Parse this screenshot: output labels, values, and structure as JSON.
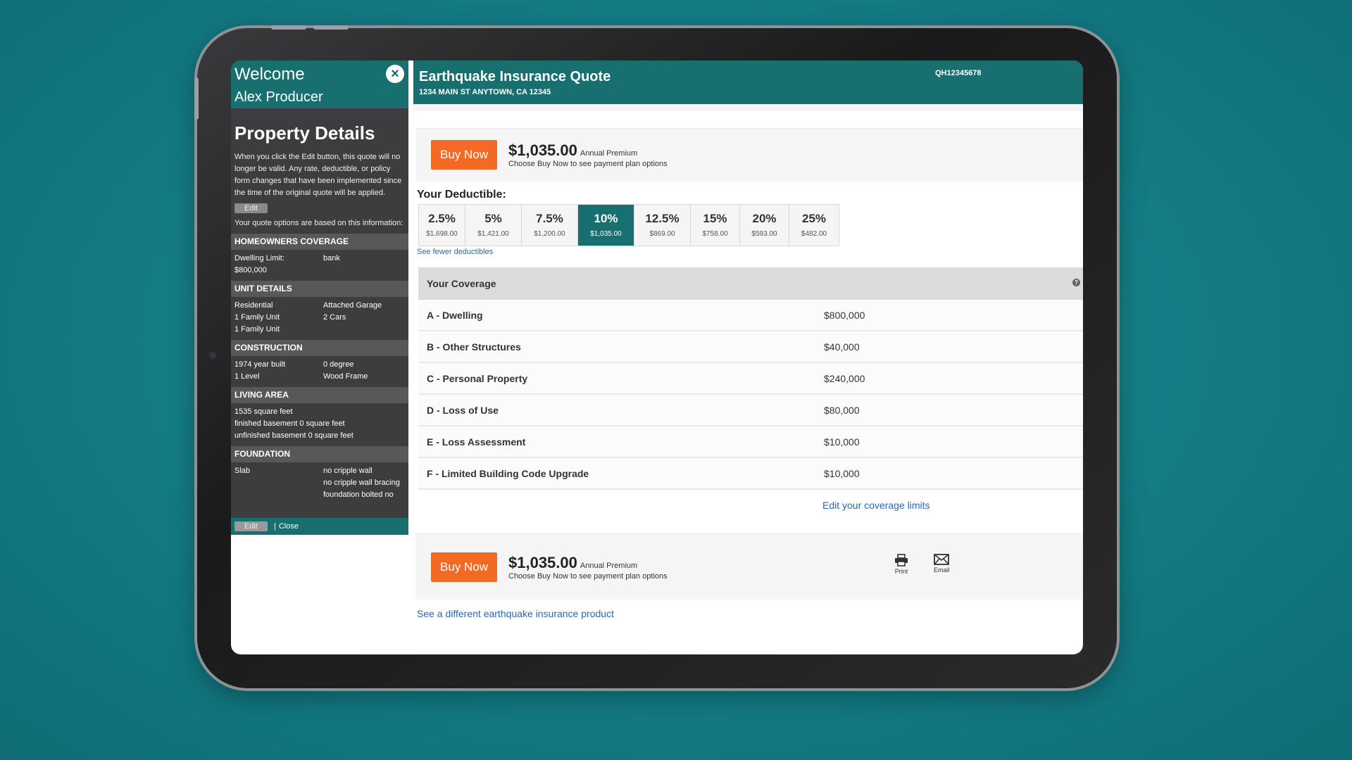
{
  "sidebar": {
    "welcome": "Welcome",
    "producer": "Alex Producer",
    "title": "Property Details",
    "edit_note": "When you click the Edit button, this quote will no longer be valid. Any rate, deductible, or policy form changes that have been implemented since the time of the original quote will be applied.",
    "edit_label": "Edit",
    "based_note": "Your quote options are based on this information:",
    "homeowners": {
      "heading": "HOMEOWNERS COVERAGE",
      "dwelling_label": "Dwelling Limit:",
      "dwelling_value": "$800,000",
      "lender": "bank"
    },
    "unit": {
      "heading": "UNIT DETAILS",
      "r1c1": "Residential",
      "r1c2": "Attached Garage",
      "r2c1": "1 Family Unit",
      "r2c2": "2 Cars",
      "r3c1": "1 Family Unit"
    },
    "construction": {
      "heading": "CONSTRUCTION",
      "r1c1": "1974 year built",
      "r1c2": "0 degree",
      "r2c1": "1 Level",
      "r2c2": "Wood Frame"
    },
    "living": {
      "heading": "LIVING AREA",
      "l1": "1535 square feet",
      "l2": "finished basement 0 square feet",
      "l3": "unfinished basement 0 square feet"
    },
    "foundation": {
      "heading": "FOUNDATION",
      "c1": "Slab",
      "l1": "no cripple wall",
      "l2": "no cripple wall bracing",
      "l3": "foundation bolted no"
    },
    "footer_edit": "Edit",
    "footer_sep": "|",
    "footer_close": "Close"
  },
  "header": {
    "title": "Earthquake Insurance Quote",
    "address": "1234 MAIN ST ANYTOWN, CA 12345",
    "quote_id": "QH12345678"
  },
  "buy": {
    "label": "Buy Now",
    "price": "$1,035.00",
    "price_label": "Annual Premium",
    "sub": "Choose Buy Now to see payment plan options"
  },
  "deductible": {
    "label": "Your Deductible:",
    "options": [
      {
        "pct": "2.5%",
        "amt": "$1,698.00"
      },
      {
        "pct": "5%",
        "amt": "$1,421.00"
      },
      {
        "pct": "7.5%",
        "amt": "$1,200.00"
      },
      {
        "pct": "10%",
        "amt": "$1,035.00"
      },
      {
        "pct": "12.5%",
        "amt": "$869.00"
      },
      {
        "pct": "15%",
        "amt": "$758.00"
      },
      {
        "pct": "20%",
        "amt": "$593.00"
      },
      {
        "pct": "25%",
        "amt": "$482.00"
      }
    ],
    "selected": "10%",
    "see_fewer": "See fewer deductibles"
  },
  "coverage": {
    "heading": "Your Coverage",
    "info_icon": "?",
    "rows": [
      {
        "name": "A - Dwelling",
        "value": "$800,000"
      },
      {
        "name": "B - Other Structures",
        "value": "$40,000"
      },
      {
        "name": "C - Personal Property",
        "value": "$240,000"
      },
      {
        "name": "D - Loss of Use",
        "value": "$80,000"
      },
      {
        "name": "E - Loss Assessment",
        "value": "$10,000"
      },
      {
        "name": "F - Limited Building Code Upgrade",
        "value": "$10,000"
      }
    ],
    "edit_limits": "Edit your coverage limits"
  },
  "actions": {
    "print": "Print",
    "email": "Email"
  },
  "footer_link": "See a different earthquake insurance product",
  "colors": {
    "teal": "#17706f",
    "orange": "#f46a24",
    "link": "#2a67b5"
  },
  "icons": {
    "close": "close-icon",
    "print": "printer-icon",
    "email": "envelope-icon",
    "info": "info-icon"
  }
}
